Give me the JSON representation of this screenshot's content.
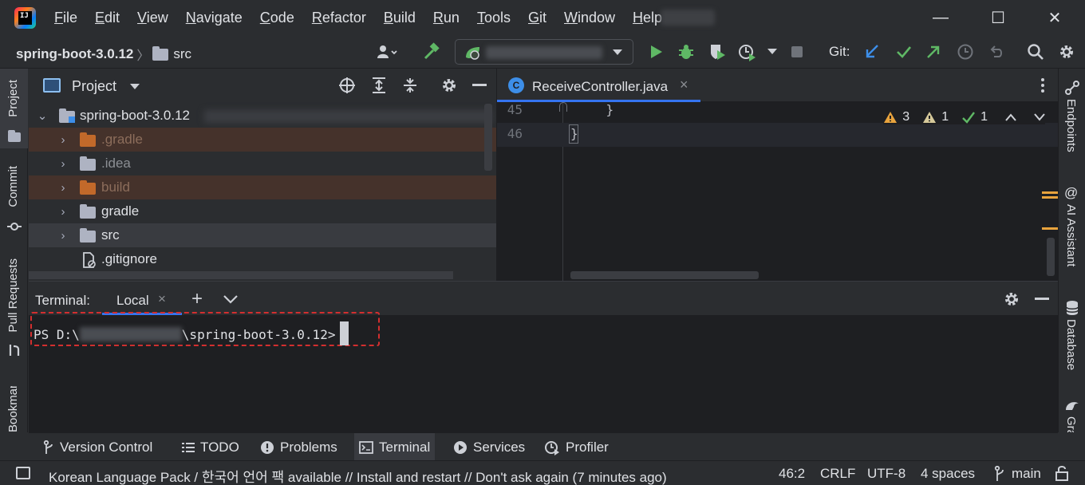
{
  "menu": [
    "File",
    "Edit",
    "View",
    "Navigate",
    "Code",
    "Refactor",
    "Build",
    "Run",
    "Tools",
    "Git",
    "Window",
    "Help"
  ],
  "window_controls": {
    "minimize": "—",
    "maximize": "☐",
    "close": "✕"
  },
  "toolbar": {
    "project_name": "spring-boot-3.0.12",
    "breadcrumb_sep": "〉",
    "crumb_folder": "src",
    "git_label": "Git:"
  },
  "left_tabs": [
    "Project",
    "Commit",
    "Pull Requests",
    "Bookmarks"
  ],
  "right_tabs": [
    "Endpoints",
    "AI Assistant",
    "Database",
    "Gradle"
  ],
  "project_panel": {
    "title": "Project",
    "root": "spring-boot-3.0.12",
    "items": [
      ".gradle",
      ".idea",
      "build",
      "gradle",
      "src",
      ".gitignore"
    ]
  },
  "editor": {
    "tab_label": "ReceiveController.java",
    "tab_close": "×",
    "lines": [
      {
        "num": "45",
        "code": "    }"
      },
      {
        "num": "46",
        "code": "}"
      }
    ],
    "inspections": {
      "errors": "3",
      "warnings": "1",
      "ok": "1"
    }
  },
  "terminal": {
    "label": "Terminal:",
    "tab": "Local",
    "tab_close": "×",
    "add": "+",
    "prompt_prefix": "PS D:\\",
    "prompt_suffix": "\\spring-boot-3.0.12>"
  },
  "bottom_tabs": [
    "Version Control",
    "TODO",
    "Problems",
    "Terminal",
    "Services",
    "Profiler"
  ],
  "status": {
    "message": "Korean Language Pack / 한국어 언어 팩 available // Install and restart // Don't ask again (7 minutes ago)",
    "position": "46:2",
    "line_sep": "CRLF",
    "encoding": "UTF-8",
    "indent": "4 spaces",
    "branch": "main"
  },
  "colors": {
    "accent": "#3574f0",
    "green": "#5fb865",
    "warning": "#e8a33d",
    "excluded_bg": "#45322b",
    "highlight_box": "#d32f2f"
  }
}
